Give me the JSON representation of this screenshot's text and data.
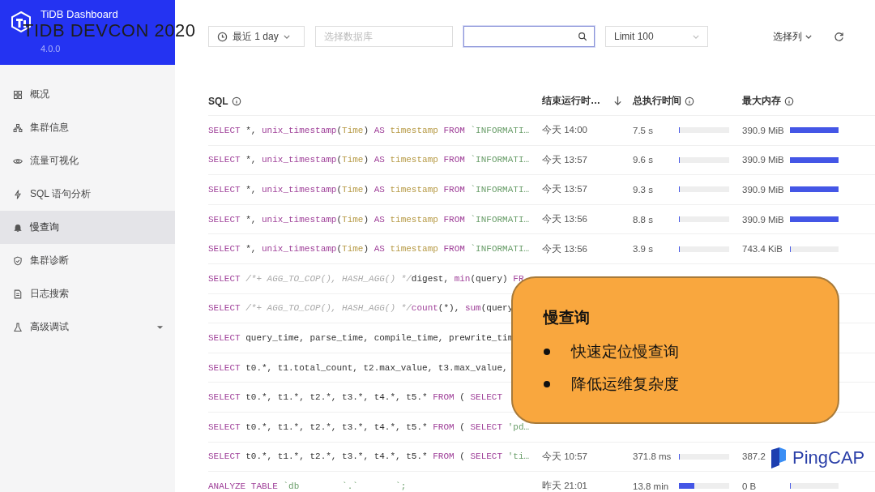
{
  "header": {
    "product": "TiDB Dashboard",
    "version": "4.0.0"
  },
  "event_title": "TIDB DEVCON 2020",
  "sidebar": {
    "items": [
      {
        "label": "概况",
        "selected": false
      },
      {
        "label": "集群信息",
        "selected": false
      },
      {
        "label": "流量可视化",
        "selected": false
      },
      {
        "label": "SQL 语句分析",
        "selected": false
      },
      {
        "label": "慢查询",
        "selected": true
      },
      {
        "label": "集群诊断",
        "selected": false
      },
      {
        "label": "日志搜索",
        "selected": false
      },
      {
        "label": "高级调试",
        "selected": false,
        "expanded": false
      }
    ]
  },
  "toolbar": {
    "time_range": "最近 1 day",
    "database": {
      "placeholder": "选择数据库"
    },
    "search": {
      "focused": true
    },
    "limit": "Limit 100",
    "columns_button": "选择列"
  },
  "table": {
    "columns": [
      {
        "label": "SQL",
        "info": true
      },
      {
        "label": "结束运行时…",
        "sorted": true
      },
      {
        "label": "总执行时间",
        "info": true
      },
      {
        "label": "最大内存",
        "info": true
      }
    ],
    "rows": [
      {
        "sql": [
          {
            "text": "SELECT",
            "kind": "keyword"
          },
          {
            "text": " *, ",
            "kind": "plain"
          },
          {
            "text": "unix_timestamp",
            "kind": "function"
          },
          {
            "text": "(",
            "kind": "plain"
          },
          {
            "text": "Time",
            "kind": "column"
          },
          {
            "text": ") ",
            "kind": "plain"
          },
          {
            "text": "AS",
            "kind": "keyword"
          },
          {
            "text": " timestamp ",
            "kind": "column"
          },
          {
            "text": "FROM",
            "kind": "keyword"
          },
          {
            "text": " `INFORMATI…",
            "kind": "string"
          }
        ],
        "end": "今天 14:00",
        "exec": {
          "text": "7.5 s",
          "level": 0.02
        },
        "mem": {
          "text": "390.9 MiB",
          "level": 1
        }
      },
      {
        "sql": [
          {
            "text": "SELECT",
            "kind": "keyword"
          },
          {
            "text": " *, ",
            "kind": "plain"
          },
          {
            "text": "unix_timestamp",
            "kind": "function"
          },
          {
            "text": "(",
            "kind": "plain"
          },
          {
            "text": "Time",
            "kind": "column"
          },
          {
            "text": ") ",
            "kind": "plain"
          },
          {
            "text": "AS",
            "kind": "keyword"
          },
          {
            "text": " timestamp ",
            "kind": "column"
          },
          {
            "text": "FROM",
            "kind": "keyword"
          },
          {
            "text": " `INFORMATI…",
            "kind": "string"
          }
        ],
        "end": "今天 13:57",
        "exec": {
          "text": "9.6 s",
          "level": 0.02
        },
        "mem": {
          "text": "390.9 MiB",
          "level": 1
        }
      },
      {
        "sql": [
          {
            "text": "SELECT",
            "kind": "keyword"
          },
          {
            "text": " *, ",
            "kind": "plain"
          },
          {
            "text": "unix_timestamp",
            "kind": "function"
          },
          {
            "text": "(",
            "kind": "plain"
          },
          {
            "text": "Time",
            "kind": "column"
          },
          {
            "text": ") ",
            "kind": "plain"
          },
          {
            "text": "AS",
            "kind": "keyword"
          },
          {
            "text": " timestamp ",
            "kind": "column"
          },
          {
            "text": "FROM",
            "kind": "keyword"
          },
          {
            "text": " `INFORMATI…",
            "kind": "string"
          }
        ],
        "end": "今天 13:57",
        "exec": {
          "text": "9.3 s",
          "level": 0.02
        },
        "mem": {
          "text": "390.9 MiB",
          "level": 1
        }
      },
      {
        "sql": [
          {
            "text": "SELECT",
            "kind": "keyword"
          },
          {
            "text": " *, ",
            "kind": "plain"
          },
          {
            "text": "unix_timestamp",
            "kind": "function"
          },
          {
            "text": "(",
            "kind": "plain"
          },
          {
            "text": "Time",
            "kind": "column"
          },
          {
            "text": ") ",
            "kind": "plain"
          },
          {
            "text": "AS",
            "kind": "keyword"
          },
          {
            "text": " timestamp ",
            "kind": "column"
          },
          {
            "text": "FROM",
            "kind": "keyword"
          },
          {
            "text": " `INFORMATI…",
            "kind": "string"
          }
        ],
        "end": "今天 13:56",
        "exec": {
          "text": "8.8 s",
          "level": 0.02
        },
        "mem": {
          "text": "390.9 MiB",
          "level": 1
        }
      },
      {
        "sql": [
          {
            "text": "SELECT",
            "kind": "keyword"
          },
          {
            "text": " *, ",
            "kind": "plain"
          },
          {
            "text": "unix_timestamp",
            "kind": "function"
          },
          {
            "text": "(",
            "kind": "plain"
          },
          {
            "text": "Time",
            "kind": "column"
          },
          {
            "text": ") ",
            "kind": "plain"
          },
          {
            "text": "AS",
            "kind": "keyword"
          },
          {
            "text": " timestamp ",
            "kind": "column"
          },
          {
            "text": "FROM",
            "kind": "keyword"
          },
          {
            "text": " `INFORMATI…",
            "kind": "string"
          }
        ],
        "end": "今天 13:56",
        "exec": {
          "text": "3.9 s",
          "level": 0.02
        },
        "mem": {
          "text": "743.4 KiB",
          "level": 0.02
        }
      },
      {
        "sql": [
          {
            "text": "SELECT",
            "kind": "keyword"
          },
          {
            "text": " /*+ AGG_TO_COP(), HASH_AGG() */",
            "kind": "comment"
          },
          {
            "text": "digest, ",
            "kind": "plain"
          },
          {
            "text": "min",
            "kind": "function"
          },
          {
            "text": "(query) ",
            "kind": "plain"
          },
          {
            "text": "FR",
            "kind": "keyword"
          }
        ]
      },
      {
        "sql": [
          {
            "text": "SELECT",
            "kind": "keyword"
          },
          {
            "text": " /*+ AGG_TO_COP(), HASH_AGG() */",
            "kind": "comment"
          },
          {
            "text": "count",
            "kind": "function"
          },
          {
            "text": "(*), ",
            "kind": "plain"
          },
          {
            "text": "sum",
            "kind": "function"
          },
          {
            "text": "(query",
            "kind": "plain"
          }
        ]
      },
      {
        "sql": [
          {
            "text": "SELECT",
            "kind": "keyword"
          },
          {
            "text": " query_time, parse_time, compile_time, prewrite_tim",
            "kind": "plain"
          }
        ]
      },
      {
        "sql": [
          {
            "text": "SELECT",
            "kind": "keyword"
          },
          {
            "text": " t0.*, t1.total_count, t2.max_value, t3.max_value,",
            "kind": "plain"
          }
        ]
      },
      {
        "sql": [
          {
            "text": "SELECT",
            "kind": "keyword"
          },
          {
            "text": " t0.*, t1.*, t2.*, t3.*, t4.*, t5.* ",
            "kind": "plain"
          },
          {
            "text": "FROM",
            "kind": "keyword"
          },
          {
            "text": " ( ",
            "kind": "plain"
          },
          {
            "text": "SELECT",
            "kind": "keyword"
          }
        ]
      },
      {
        "sql": [
          {
            "text": "SELECT",
            "kind": "keyword"
          },
          {
            "text": " t0.*, t1.*, t2.*, t3.*, t4.*, t5.* ",
            "kind": "plain"
          },
          {
            "text": "FROM",
            "kind": "keyword"
          },
          {
            "text": " ( ",
            "kind": "plain"
          },
          {
            "text": "SELECT",
            "kind": "keyword"
          },
          {
            "text": " 'pd…",
            "kind": "string"
          }
        ]
      },
      {
        "sql": [
          {
            "text": "SELECT",
            "kind": "keyword"
          },
          {
            "text": " t0.*, t1.*, t2.*, t3.*, t4.*, t5.* ",
            "kind": "plain"
          },
          {
            "text": "FROM",
            "kind": "keyword"
          },
          {
            "text": " ( ",
            "kind": "plain"
          },
          {
            "text": "SELECT",
            "kind": "keyword"
          },
          {
            "text": " 'ti…",
            "kind": "string"
          }
        ],
        "end": "今天 10:57",
        "exec": {
          "text": "371.8 ms",
          "level": 0
        },
        "mem": {
          "text": "387.2"
        }
      },
      {
        "sql": [
          {
            "text": "ANALYZE TABLE",
            "kind": "keyword"
          },
          {
            "text": " `db        `.`       `;",
            "kind": "string"
          }
        ],
        "end": "昨天 21:01",
        "exec": {
          "text": "13.8 min",
          "level": 0.3
        },
        "mem": {
          "text": "0 B",
          "level": 0
        }
      }
    ]
  },
  "callout": {
    "title": "慢查询",
    "bullets": [
      "快速定位慢查询",
      "降低运维复杂度"
    ]
  },
  "brand": {
    "name": "PingCAP"
  }
}
